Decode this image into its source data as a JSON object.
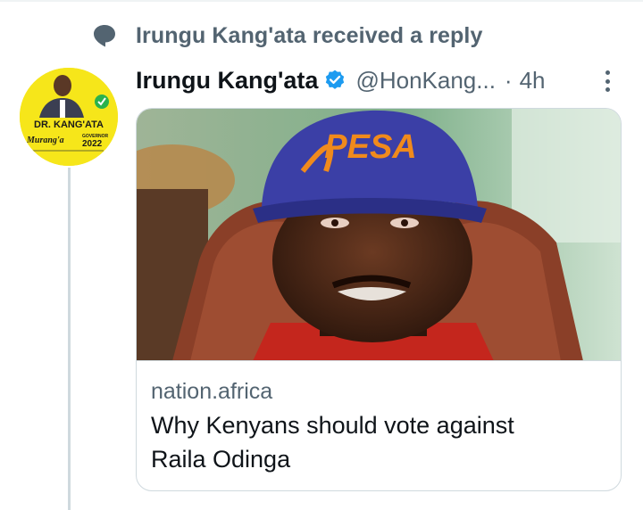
{
  "social_context": {
    "text": "Irungu Kang'ata received a reply",
    "icon": "speech-bubble-icon"
  },
  "avatar": {
    "line1": "DR. KANG'ATA",
    "line2": "Murang'a",
    "badge": "GOVERNOR",
    "year": "2022",
    "colors": {
      "background": "#f6e61a",
      "accent_green": "#2bb24c"
    }
  },
  "tweet": {
    "author_name": "Irungu Kang'ata",
    "handle": "@HonKang...",
    "separator": "·",
    "time": "4h",
    "verified": true
  },
  "link_card": {
    "domain": "nation.africa",
    "title_line1": "Why Kenyans should vote against",
    "title_line2": "Raila Odinga",
    "image_alt": "Man wearing blue PESA cap",
    "cap_text": "PESA"
  },
  "colors": {
    "text_primary": "#0f1419",
    "text_secondary": "#536471",
    "border": "#cfd9de",
    "verified_blue": "#1d9bf0"
  }
}
